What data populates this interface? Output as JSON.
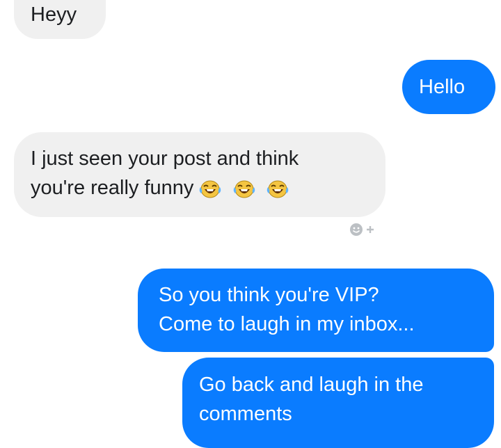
{
  "messages": [
    {
      "text": "Heyy"
    },
    {
      "text": "Hello"
    },
    {
      "line1": "I just seen your post and think",
      "line2": "you're really funny",
      "emojis": [
        "laughing-tears-emoji",
        "laughing-tears-emoji",
        "laughing-tears-emoji"
      ]
    },
    {
      "line1": "So you think you're VIP?",
      "line2": "Come to laugh in my inbox..."
    },
    {
      "line1": "Go back and laugh in the",
      "line2": "comments"
    }
  ],
  "reaction_button": {
    "icon": "add-reaction-icon"
  },
  "colors": {
    "incoming_bubble": "#f0f0f0",
    "outgoing_bubble": "#0a7cff",
    "incoming_text": "#1c1e21",
    "outgoing_text": "#ffffff"
  }
}
